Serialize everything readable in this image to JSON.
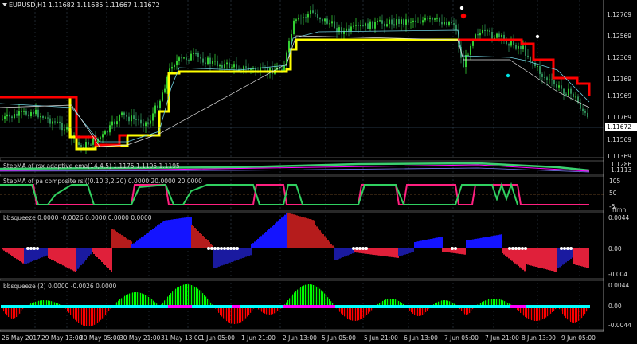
{
  "header": {
    "symbol_line": "EURUSD,H1  1.11682 1.11685 1.11667 1.11672"
  },
  "main": {
    "current_price": "1.11672",
    "yticks": [
      "1.12769",
      "1.12569",
      "1.12369",
      "1.12169",
      "1.11969",
      "1.11769",
      "1.11569",
      "1.11369"
    ]
  },
  "panel_stepma_rsx": {
    "title": "StepMA of rsx adaptive ema(14,4,5) 1.1175 1.1195 1.1195",
    "yticks": [
      "1.1286",
      "1.1113"
    ]
  },
  "panel_stepma_pa": {
    "title": "StepMA of pa composite rsi((0.10,3,2,20) 0.0000 20.0000 20.0000",
    "yticks": [
      "105",
      "50",
      "-5"
    ],
    "bottom_label": "ffmn"
  },
  "panel_bbsqueeze": {
    "title": "bbsqueeze 0.0000 -0.0026 0.0000 0.0000 0.0000",
    "yticks": [
      "0.0044",
      "0.00",
      "-0.004"
    ]
  },
  "panel_bbsqueeze2": {
    "title": "bbsqueeze (2) 0.0000 -0.0026 0.0000",
    "yticks": [
      "0.0044",
      "0.00",
      "-0.0044"
    ]
  },
  "xaxis": {
    "labels": [
      "26 May 2017",
      "29 May 13:00",
      "30 May 05:00",
      "30 May 21:00",
      "31 May 13:00",
      "1 Jun 05:00",
      "1 Jun 21:00",
      "2 Jun 13:00",
      "5 Jun 05:00",
      "5 Jun 21:00",
      "6 Jun 13:00",
      "7 Jun 05:00",
      "7 Jun 21:00",
      "8 Jun 13:00",
      "9 Jun 05:00"
    ]
  },
  "colors": {
    "background": "#000000",
    "bull_candle": "#32cd32",
    "bear_candle": "#2e8b57",
    "stepma_yellow": "#ffff00",
    "stepma_red": "#ff0000",
    "separator": "#808080",
    "squeeze_blue": "#0000ff",
    "squeeze_red": "#b22222",
    "histogram_green": "#00ff00",
    "histogram_red": "#ff0000",
    "dots_cyan": "#00ffff",
    "dots_magenta": "#ff00ff"
  }
}
